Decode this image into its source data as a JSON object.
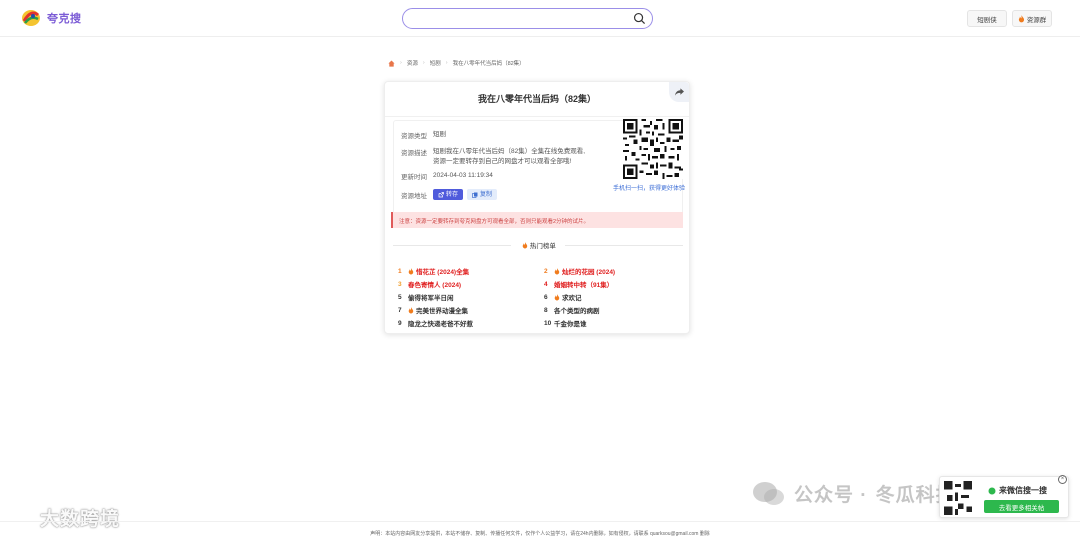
{
  "header": {
    "logo_text": "夸克搜",
    "search": {
      "value": "",
      "placeholder": ""
    },
    "btn_shortdrama": "短剧侠",
    "btn_resource": "资源群"
  },
  "breadcrumb": [
    "资源",
    "短剧",
    "我在八零年代当后妈（82集）"
  ],
  "detail": {
    "title": "我在八零年代当后妈（82集）",
    "type_label": "资源类型",
    "type_value": "短剧",
    "desc_label": "资源描述",
    "desc_line1": "短剧我在八零年代当后妈（82集）全集在线免费观看,",
    "desc_line2": "资源一定要转存到自己的网盘才可以观看全部哦!",
    "time_label": "更新时间",
    "time_value": "2024-04-03 11:19:34",
    "addr_label": "资源地址",
    "save_label": "转存",
    "copy_label": "复制",
    "qr_caption": "手机扫一扫，获得更好体验",
    "notice": "注意：资源一定要转存到夸克网盘方可观看全部，否则只能观看2分钟的试片。"
  },
  "hot": {
    "title": "热门榜单",
    "items": [
      {
        "rank": "1",
        "title": "惜花芷 (2024)全集",
        "color": "#e02020",
        "fire": true,
        "bold": true
      },
      {
        "rank": "2",
        "title": "灿烂的花园 (2024)",
        "color": "#e02020",
        "fire": true,
        "bold": true
      },
      {
        "rank": "3",
        "title": "春色寄情人 (2024)",
        "color": "#e02020",
        "fire": false,
        "bold": true
      },
      {
        "rank": "4",
        "title": "婚姻转中转（91集）",
        "color": "#e02020",
        "fire": false,
        "bold": true
      },
      {
        "rank": "5",
        "title": "偷得将军半日闲",
        "color": "#333333",
        "fire": false,
        "bold": true
      },
      {
        "rank": "6",
        "title": "求欢记",
        "color": "#333333",
        "fire": true,
        "bold": true
      },
      {
        "rank": "7",
        "title": "完美世界动漫全集",
        "color": "#333333",
        "fire": true,
        "bold": true
      },
      {
        "rank": "8",
        "title": "各个类型的病剧",
        "color": "#333333",
        "fire": false,
        "bold": true
      },
      {
        "rank": "9",
        "title": "隐龙之快递老爸不好惹",
        "color": "#333333",
        "fire": false,
        "bold": true
      },
      {
        "rank": "10",
        "title": "千金你是谁",
        "color": "#333333",
        "fire": false,
        "bold": true
      }
    ]
  },
  "footer": {
    "text": "声明：本站内容由网友分享提供，本站不储存、复制、传播任何文件，仅作个人公益学习，请在24h内删除，如有侵权，请联系 quarksou@gmail.com 删除"
  },
  "watermark": {
    "left": "大数跨境",
    "right_prefix": "公众号 ·",
    "right_name": "冬瓜科技"
  },
  "float": {
    "label": "来微信搜一搜",
    "button": "去看更多相关帖"
  }
}
